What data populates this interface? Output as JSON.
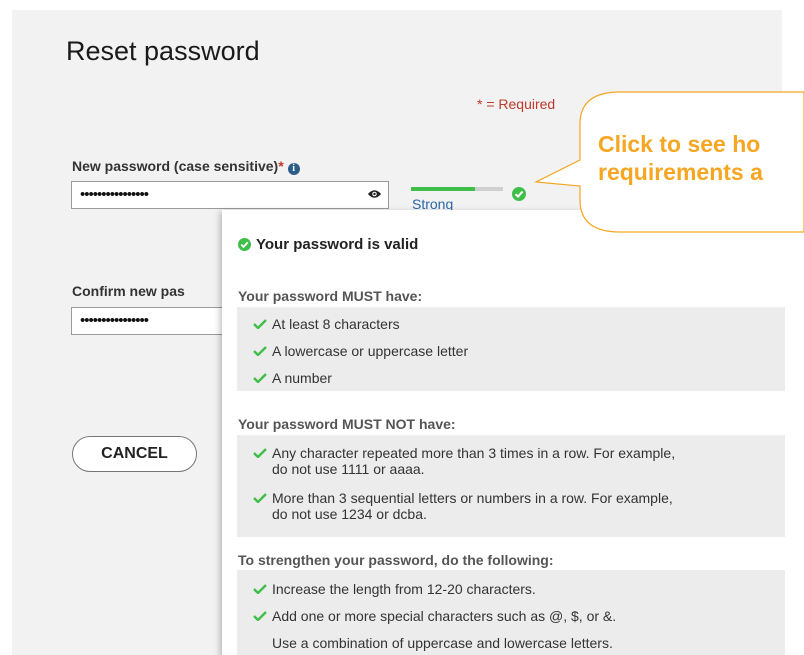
{
  "page": {
    "title": "Reset password",
    "required_note": "* = Required"
  },
  "new_password": {
    "label": "New password (case sensitive)",
    "required_star": "*",
    "info_icon": "i",
    "value": "••••••••••••••••"
  },
  "strength": {
    "label": "Strong",
    "level_percent": 70,
    "bar_color": "#3fbf4a",
    "label_color": "#2b67a8"
  },
  "confirm_password": {
    "label": "Confirm new pas",
    "value": "••••••••••••••••"
  },
  "cancel_label": "CANCEL",
  "callout": {
    "line1": "Click to see ho",
    "line2": "requirements a",
    "color": "#f5a623"
  },
  "popup": {
    "valid_message": "Your password is valid",
    "must_have": {
      "heading": "Your password MUST have:",
      "items": [
        "At least 8 characters",
        "A lowercase or uppercase letter",
        "A number"
      ]
    },
    "must_not_have": {
      "heading": "Your password MUST NOT have:",
      "items": [
        {
          "line1": "Any character repeated more than 3 times in a row. For example,",
          "line2": "do not use 1111 or aaaa."
        },
        {
          "line1": "More than 3 sequential letters or numbers in a row. For example,",
          "line2": "do not use 1234 or dcba."
        }
      ]
    },
    "strengthen": {
      "heading": "To strengthen your password, do the following:",
      "items": [
        "Increase the length from 12-20 characters.",
        "Add one or more special characters such as @, $, or &.",
        "Use a combination of uppercase and lowercase letters."
      ]
    }
  },
  "colors": {
    "check_green": "#3fbf4a",
    "required_red": "#c0392b",
    "info_blue": "#2a5d8a"
  }
}
